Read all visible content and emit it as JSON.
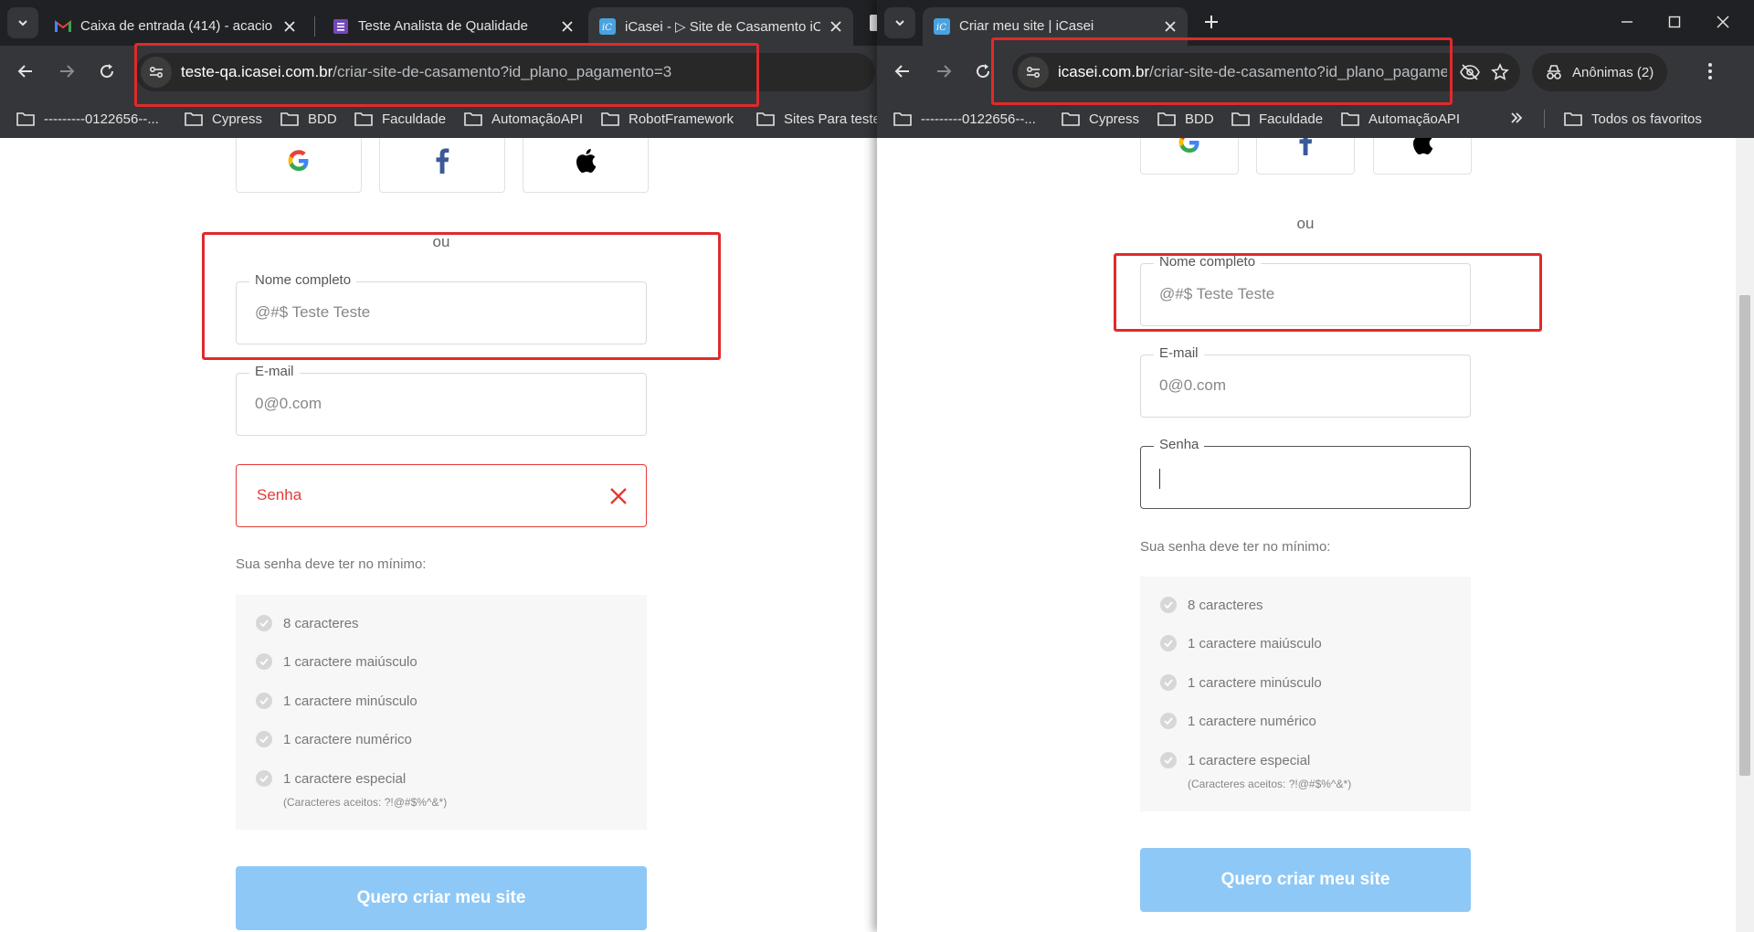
{
  "left_window": {
    "tabs": [
      {
        "title": "Caixa de entrada (414) - acacio"
      },
      {
        "title": "Teste Analista de Qualidade"
      },
      {
        "title": "iCasei - ▷ Site de Casamento iC"
      }
    ],
    "url_host": "teste-qa.icasei.com.br",
    "url_path": "/criar-site-de-casamento?id_plano_pagamento=3",
    "bookmarks": [
      "---------0122656--...",
      "Cypress",
      "BDD",
      "Faculdade",
      "AutomaçãoAPI",
      "RobotFramework",
      "Sites Para teste"
    ],
    "form": {
      "or_text": "ou",
      "name_label": "Nome completo",
      "name_value": "@#$ Teste Teste",
      "email_label": "E-mail",
      "email_value": "0@0.com",
      "password_placeholder": "Senha",
      "password_hint": "Sua senha deve ter no mínimo:",
      "requirements": [
        "8 caracteres",
        "1 caractere maiúsculo",
        "1 caractere minúsculo",
        "1 caractere numérico",
        "1 caractere especial"
      ],
      "accepted_chars": "(Caracteres aceitos: ?!@#$%^&*)",
      "submit_label": "Quero criar meu site"
    }
  },
  "right_window": {
    "tab_title": "Criar meu site | iCasei",
    "url_host": "icasei.com.br",
    "url_path": "/criar-site-de-casamento?id_plano_pagamen...",
    "incognito_label": "Anônimas (2)",
    "bookmarks": [
      "---------0122656--...",
      "Cypress",
      "BDD",
      "Faculdade",
      "AutomaçãoAPI"
    ],
    "all_bookmarks_label": "Todos os favoritos",
    "form": {
      "or_text": "ou",
      "name_label": "Nome completo",
      "name_value": "@#$ Teste Teste",
      "email_label": "E-mail",
      "email_value": "0@0.com",
      "password_label": "Senha",
      "password_hint": "Sua senha deve ter no mínimo:",
      "requirements": [
        "8 caracteres",
        "1 caractere maiúsculo",
        "1 caractere minúsculo",
        "1 caractere numérico",
        "1 caractere especial"
      ],
      "accepted_chars": "(Caracteres aceitos: ?!@#$%^&*)",
      "submit_label": "Quero criar meu site"
    }
  },
  "colors": {
    "highlight": "#e02a2a",
    "error": "#e53935",
    "cta": "#8ec8f6",
    "chrome_dark": "#202124",
    "chrome_toolbar": "#35363a"
  }
}
